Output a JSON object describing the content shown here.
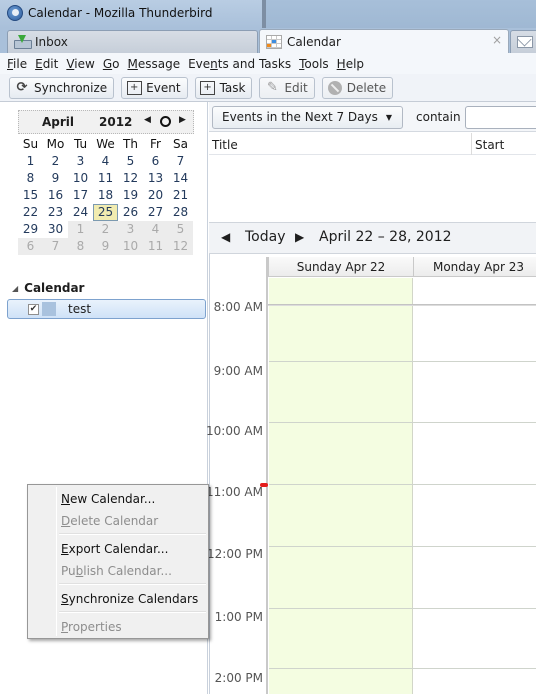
{
  "window": {
    "title": "Calendar - Mozilla Thunderbird"
  },
  "tabs": [
    {
      "label": "Inbox",
      "icon": "inbox-download-icon",
      "active": false
    },
    {
      "label": "Calendar",
      "icon": "calendar-icon",
      "active": true,
      "close": "×"
    },
    {
      "label": "",
      "icon": "mail-envelope-icon",
      "active": false
    }
  ],
  "menubar": {
    "items": [
      {
        "label": "File",
        "accel": "F"
      },
      {
        "label": "Edit",
        "accel": "E"
      },
      {
        "label": "View",
        "accel": "V"
      },
      {
        "label": "Go",
        "accel": "G"
      },
      {
        "label": "Message",
        "accel": "M"
      },
      {
        "label": "Events and Tasks",
        "accel": "n"
      },
      {
        "label": "Tools",
        "accel": "T"
      },
      {
        "label": "Help",
        "accel": "H"
      }
    ]
  },
  "toolbar": {
    "synchronize": "Synchronize",
    "event": "Event",
    "task": "Task",
    "edit": "Edit",
    "delete": "Delete"
  },
  "minimonth": {
    "month": "April",
    "year": "2012",
    "prev": "◀",
    "next": "▶",
    "weekdays": [
      "Su",
      "Mo",
      "Tu",
      "We",
      "Th",
      "Fr",
      "Sa"
    ],
    "days": [
      {
        "d": "1",
        "other": false
      },
      {
        "d": "2",
        "other": false
      },
      {
        "d": "3",
        "other": false
      },
      {
        "d": "4",
        "other": false
      },
      {
        "d": "5",
        "other": false
      },
      {
        "d": "6",
        "other": false
      },
      {
        "d": "7",
        "other": false
      },
      {
        "d": "8",
        "other": false
      },
      {
        "d": "9",
        "other": false
      },
      {
        "d": "10",
        "other": false
      },
      {
        "d": "11",
        "other": false
      },
      {
        "d": "12",
        "other": false
      },
      {
        "d": "13",
        "other": false
      },
      {
        "d": "14",
        "other": false
      },
      {
        "d": "15",
        "other": false
      },
      {
        "d": "16",
        "other": false
      },
      {
        "d": "17",
        "other": false
      },
      {
        "d": "18",
        "other": false
      },
      {
        "d": "19",
        "other": false
      },
      {
        "d": "20",
        "other": false
      },
      {
        "d": "21",
        "other": false
      },
      {
        "d": "22",
        "other": false
      },
      {
        "d": "23",
        "other": false
      },
      {
        "d": "24",
        "other": false
      },
      {
        "d": "25",
        "other": false,
        "today": true
      },
      {
        "d": "26",
        "other": false
      },
      {
        "d": "27",
        "other": false
      },
      {
        "d": "28",
        "other": false
      },
      {
        "d": "29",
        "other": false
      },
      {
        "d": "30",
        "other": false
      },
      {
        "d": "1",
        "other": true
      },
      {
        "d": "2",
        "other": true
      },
      {
        "d": "3",
        "other": true
      },
      {
        "d": "4",
        "other": true
      },
      {
        "d": "5",
        "other": true
      },
      {
        "d": "6",
        "other": true
      },
      {
        "d": "7",
        "other": true
      },
      {
        "d": "8",
        "other": true
      },
      {
        "d": "9",
        "other": true
      },
      {
        "d": "10",
        "other": true
      },
      {
        "d": "11",
        "other": true
      },
      {
        "d": "12",
        "other": true
      }
    ]
  },
  "calendar_list": {
    "header": "Calendar",
    "twisty": "◢",
    "items": [
      {
        "name": "test",
        "checked": true,
        "color": "#a9c2de"
      }
    ]
  },
  "filter": {
    "selected": "Events in the Next 7 Days",
    "arrow": "▼",
    "contain_label": "contain",
    "search_value": ""
  },
  "event_list": {
    "columns": [
      "Title",
      "Start"
    ]
  },
  "view_nav": {
    "prev": "◀",
    "today": "Today",
    "next": "▶",
    "range": "April 22 – 28, 2012"
  },
  "week_view": {
    "days": [
      "Sunday Apr 22",
      "Monday Apr 23"
    ],
    "hours": [
      "8:00 AM",
      "9:00 AM",
      "10:00 AM",
      "11:00 AM",
      "12:00 PM",
      "1:00 PM",
      "2:00 PM"
    ]
  },
  "context_menu": {
    "items": [
      {
        "label": "New Calendar...",
        "accel": "N",
        "disabled": false
      },
      {
        "label": "Delete Calendar",
        "accel": "D",
        "disabled": true
      },
      {
        "label": "Export Calendar...",
        "accel": "E",
        "disabled": false
      },
      {
        "label": "Publish Calendar...",
        "accel": "b",
        "disabled": true
      },
      {
        "label": "Synchronize Calendars",
        "accel": "S",
        "disabled": false
      },
      {
        "label": "Properties",
        "accel": "P",
        "disabled": true
      }
    ]
  },
  "colors": {
    "today_highlight": "#f1ecb0",
    "selected_day_column": "#f4fde1",
    "now_marker": "#e41c1c"
  }
}
